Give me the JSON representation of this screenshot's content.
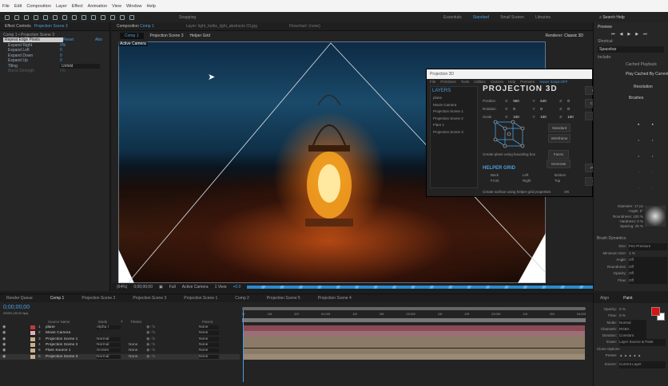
{
  "menu": [
    "File",
    "Edit",
    "Composition",
    "Layer",
    "Effect",
    "Animation",
    "View",
    "Window",
    "Help"
  ],
  "toolbar": {
    "snapping": "Snapping"
  },
  "workspaces": [
    "Essentials",
    "Standard",
    "Small Screen",
    "Libraries"
  ],
  "search_help": "Search Help",
  "effect_controls": {
    "tab": "Effect Controls",
    "tab_layer": "Projection Scene 3",
    "breadcrumb": "Comp 1 • Projection Scene 3",
    "effect_name": "Repeat Edge Pixels",
    "reset": "Reset",
    "about": "Abo",
    "params": [
      {
        "label": "Expand Right",
        "value": "0%"
      },
      {
        "label": "Expand Left",
        "value": "0"
      },
      {
        "label": "Expand Down",
        "value": "0"
      },
      {
        "label": "Expand Up",
        "value": "0"
      },
      {
        "label": "Tiling",
        "value": "Unfold"
      },
      {
        "label": "Blend Strength",
        "value": "0%"
      }
    ]
  },
  "composition": {
    "tab": "Composition",
    "tab_comp": "Comp 1",
    "layer_tab": "Layer: light_bulbs_light_abstracts 03.jpg",
    "flowchart": "Flowchart: (none)",
    "breadcrumbs": [
      "Comp 1",
      "Projection Scene 3",
      "Helper Grid"
    ],
    "renderer_label": "Renderer:",
    "renderer": "Classic 3D",
    "camera_label": "Active Camera",
    "bottom": {
      "zoom": "(64%)",
      "timecode": "0;00;00;00",
      "resolution": "Full",
      "view": "Active Camera",
      "views": "1 View",
      "exposure": "+0.0"
    }
  },
  "projection3d": {
    "window_title": "Projection 3D",
    "menu": [
      "File",
      "Primitives",
      "Tools",
      "Utilities",
      "Camera",
      "Help",
      "Premiere",
      "Hover Script OFF"
    ],
    "heading": "PROJECTION 3D",
    "layers_title": "LAYERS",
    "layers": [
      "plane",
      "Movie Camera",
      "Projection Scene 1",
      "Projection Scene 2",
      "Flare 1",
      "Projection Scene 3"
    ],
    "position": {
      "label": "Position",
      "x": "960",
      "y": "540",
      "z": "0"
    },
    "rotation": {
      "label": "Rotation",
      "x": "0",
      "y": "0",
      "z": "0"
    },
    "scale": {
      "label": "Scale",
      "x": "100",
      "y": "100",
      "z": "100"
    },
    "standard": "Standard",
    "wireframe": "Wireframe",
    "create_plane": "Create plane using bounding box",
    "faces": "Faces",
    "generate": "Generate",
    "helper_grid": "HELPER GRID",
    "grid": [
      "Back",
      "Front",
      "Left",
      "Right",
      "Bottom",
      "Top"
    ],
    "create_surface": "Create surface using helper grid properties",
    "ok": "OK",
    "buttons": [
      "Match Camera",
      "Create Projection",
      "Add Scene",
      "Projection Image",
      "Group Objects"
    ]
  },
  "right": {
    "preview": "Preview",
    "shortcut": "Shortcut",
    "shortcut_value": "Spacebar",
    "include": "Include:",
    "cached": "Cached Playback",
    "range": "Play Cached By Current Ti",
    "resolution": "Resolution",
    "brushes": "Brushes",
    "brush_props": [
      {
        "label": "Diameter:",
        "value": "17 px"
      },
      {
        "label": "Angle:",
        "value": "0°"
      },
      {
        "label": "Roundness:",
        "value": "100 %"
      },
      {
        "label": "Hardness:",
        "value": "0 %"
      },
      {
        "label": "Spacing:",
        "value": "25 %"
      }
    ],
    "brush_dynamics": "Brush Dynamics",
    "dyn": [
      {
        "label": "Size:",
        "value": "Pen Pressure"
      },
      {
        "label": "Minimum Size:",
        "value": "1 %"
      },
      {
        "label": "Angle:",
        "value": "Off"
      },
      {
        "label": "Roundness:",
        "value": "Off"
      },
      {
        "label": "Opacity:",
        "value": "Off"
      },
      {
        "label": "Flow:",
        "value": "Off"
      }
    ],
    "align": "Align",
    "paint": "Paint",
    "paint_props": [
      {
        "label": "Opacity:",
        "value": "0 %"
      },
      {
        "label": "Flow:",
        "value": "0 %"
      },
      {
        "label": "Mode:",
        "value": "Normal"
      },
      {
        "label": "Channels:",
        "value": "RGBA"
      },
      {
        "label": "Duration:",
        "value": "Constant"
      },
      {
        "label": "Erase:",
        "value": "Layer Source & Paint"
      }
    ],
    "clone_options": "Clone Options",
    "preset": "Preset:",
    "source": "Source:",
    "source_value": "Current Layer",
    "fg_color": "#e01010",
    "bg_color": "#ffffff"
  },
  "timeline": {
    "tabs": [
      "Render Queue",
      "Comp 1",
      "Projection Scene 2",
      "Projection Scene 3",
      "Projection Scene 1",
      "Comp 2",
      "Projection Scene 5",
      "Projection Scene 4"
    ],
    "timecode": "0;00;00;00",
    "fps": "00000 (30.00 fps)",
    "col_source": "Source Name",
    "col_mode": "Mode",
    "col_t": "T",
    "col_trkmat": "TrkMat",
    "col_parent": "Parent",
    "ruler": [
      "0f",
      "10f",
      "20f",
      "01:00f",
      "10f",
      "20f",
      "02:00f",
      "10f",
      "20f",
      "03:00f",
      "10f",
      "20f",
      "04:00f"
    ],
    "layers": [
      {
        "num": "1",
        "name": "plane",
        "mode": "Alpha I",
        "trk": "",
        "parent": "None",
        "color": "#c83838",
        "bar": "#8a4a55"
      },
      {
        "num": "2",
        "name": "Movie Camera",
        "mode": "",
        "trk": "",
        "parent": "None",
        "color": "#e0b0b8",
        "bar": "#9a7076"
      },
      {
        "num": "3",
        "name": "Projection Scene 1",
        "mode": "Normal",
        "trk": "",
        "parent": "None",
        "color": "#c8b090",
        "bar": "#8a7a66"
      },
      {
        "num": "4",
        "name": "Projection Scene 2",
        "mode": "Normal",
        "trk": "None",
        "parent": "None",
        "color": "#c8b090",
        "bar": "#8a7a66"
      },
      {
        "num": "5",
        "name": "Flare Source 1",
        "mode": "Screen",
        "trk": "None",
        "parent": "None",
        "color": "#c8b090",
        "bar": "#8a7a66"
      },
      {
        "num": "6",
        "name": "Projection Scene 3",
        "mode": "Normal",
        "trk": "None",
        "parent": "None",
        "color": "#c8b090",
        "bar": "#9a8a76"
      }
    ]
  }
}
